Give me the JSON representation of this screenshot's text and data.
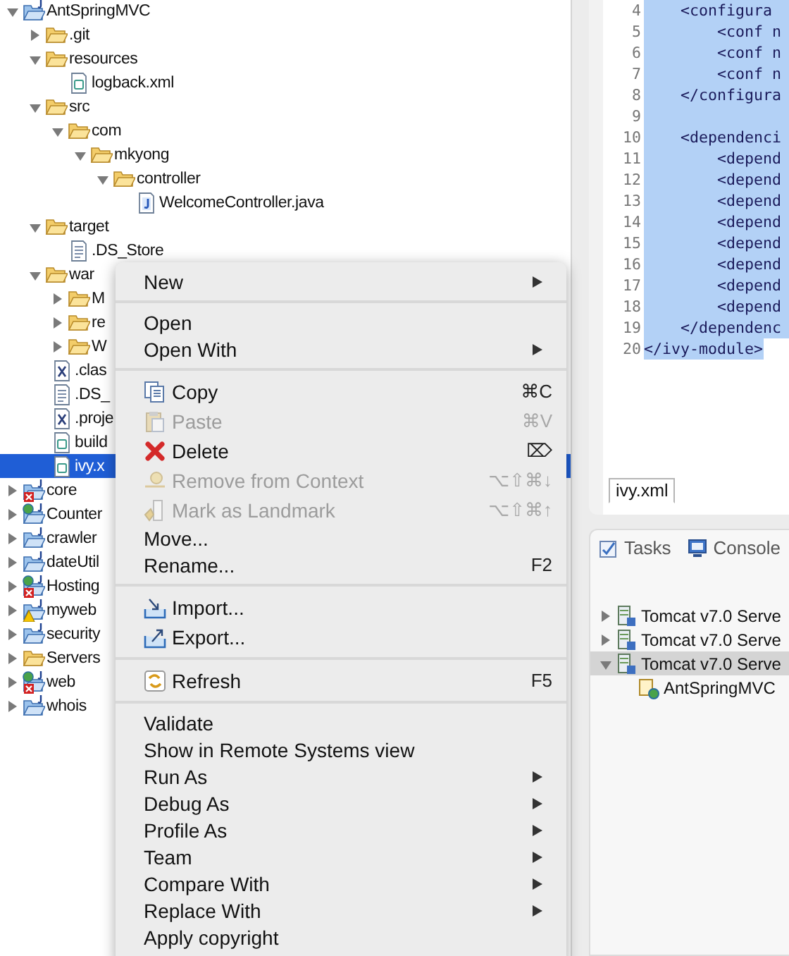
{
  "project_tree": {
    "items": [
      {
        "label": "AntSpringMVC",
        "kind": "project",
        "expanded": true,
        "selected": false,
        "children": [
          {
            "label": ".git",
            "kind": "folder",
            "expanded": false,
            "selected": false
          },
          {
            "label": "resources",
            "kind": "folder",
            "expanded": true,
            "selected": false,
            "children": [
              {
                "label": "logback.xml",
                "kind": "xml",
                "selected": false
              }
            ]
          },
          {
            "label": "src",
            "kind": "folder",
            "expanded": true,
            "selected": false,
            "children": [
              {
                "label": "com",
                "kind": "folder",
                "expanded": true,
                "selected": false,
                "children": [
                  {
                    "label": "mkyong",
                    "kind": "folder",
                    "expanded": true,
                    "selected": false,
                    "children": [
                      {
                        "label": "controller",
                        "kind": "folder",
                        "expanded": true,
                        "selected": false,
                        "children": [
                          {
                            "label": "WelcomeController.java",
                            "kind": "java",
                            "selected": false
                          }
                        ]
                      }
                    ]
                  }
                ]
              }
            ]
          },
          {
            "label": "target",
            "kind": "folder",
            "expanded": true,
            "selected": false,
            "children": [
              {
                "label": ".DS_Store",
                "kind": "text",
                "selected": false
              }
            ]
          },
          {
            "label": "war",
            "kind": "folder",
            "expanded": true,
            "selected": false,
            "children": [
              {
                "label": "M",
                "kind": "folder",
                "expanded": false,
                "selected": false
              },
              {
                "label": "re",
                "kind": "folder",
                "expanded": false,
                "selected": false
              },
              {
                "label": "W",
                "kind": "folder",
                "expanded": false,
                "selected": false
              },
              {
                "label": ".clas",
                "kind": "x-file",
                "selected": false
              },
              {
                "label": ".DS_",
                "kind": "text",
                "selected": false
              },
              {
                "label": ".proje",
                "kind": "x-file",
                "selected": false
              },
              {
                "label": "build",
                "kind": "xml",
                "selected": false
              },
              {
                "label": "ivy.x",
                "kind": "xml",
                "selected": true
              }
            ]
          }
        ]
      },
      {
        "label": "core",
        "kind": "project-error",
        "expanded": false,
        "selected": false
      },
      {
        "label": "Counter",
        "kind": "project-web",
        "expanded": false,
        "selected": false
      },
      {
        "label": "crawler",
        "kind": "project",
        "expanded": false,
        "selected": false
      },
      {
        "label": "dateUtil",
        "kind": "project",
        "expanded": false,
        "selected": false
      },
      {
        "label": "Hosting",
        "kind": "project-web-error",
        "expanded": false,
        "selected": false
      },
      {
        "label": "myweb",
        "kind": "project-warning",
        "expanded": false,
        "selected": false
      },
      {
        "label": "security",
        "kind": "project",
        "expanded": false,
        "selected": false
      },
      {
        "label": "Servers",
        "kind": "folder",
        "expanded": false,
        "selected": false
      },
      {
        "label": "web",
        "kind": "project-web-error",
        "expanded": false,
        "selected": false
      },
      {
        "label": "whois",
        "kind": "project",
        "expanded": false,
        "selected": false
      }
    ]
  },
  "editor": {
    "lines": [
      {
        "number": "4",
        "code": "    <configura",
        "selected": true
      },
      {
        "number": "5",
        "code": "        <conf n",
        "selected": true
      },
      {
        "number": "6",
        "code": "        <conf n",
        "selected": true
      },
      {
        "number": "7",
        "code": "        <conf n",
        "selected": true
      },
      {
        "number": "8",
        "code": "    </configura",
        "selected": true
      },
      {
        "number": "9",
        "selected": true
      },
      {
        "number": "10",
        "code": "    <dependenci",
        "selected": true
      },
      {
        "number": "11",
        "code": "        <depend",
        "selected": true
      },
      {
        "number": "12",
        "code": "        <depend",
        "selected": true
      },
      {
        "number": "13",
        "code": "        <depend",
        "selected": true
      },
      {
        "number": "14",
        "code": "        <depend",
        "selected": true
      },
      {
        "number": "15",
        "code": "        <depend",
        "selected": true
      },
      {
        "number": "16",
        "code": "        <depend",
        "selected": true
      },
      {
        "number": "17",
        "code": "        <depend",
        "selected": true
      },
      {
        "number": "18",
        "code": "        <depend",
        "selected": true
      },
      {
        "number": "19",
        "code": "    </dependenc",
        "selected": true
      },
      {
        "number": "20",
        "code": "</ivy-module>",
        "selected": true
      }
    ],
    "tabs": [
      {
        "label": "ivy.xml",
        "selected": true
      }
    ]
  },
  "bottom_panel": {
    "tabs": [
      {
        "label": "Tasks",
        "kind": "tasks",
        "selected": false
      },
      {
        "label": "Console",
        "kind": "console",
        "selected": false
      }
    ],
    "servers": [
      {
        "label": "Tomcat v7.0 Serve",
        "expanded": false,
        "selected": false
      },
      {
        "label": "Tomcat v7.0 Serve",
        "expanded": false,
        "selected": false
      },
      {
        "label": "Tomcat v7.0 Serve",
        "expanded": true,
        "selected": true,
        "children": [
          {
            "label": "AntSpringMVC",
            "selected": false
          }
        ]
      }
    ]
  },
  "context_menu": {
    "groups": [
      {
        "items": [
          {
            "label": "New",
            "kind": "plain",
            "submenu": true,
            "disabled": false
          }
        ]
      },
      {
        "items": [
          {
            "label": "Open",
            "kind": "plain",
            "submenu": false,
            "disabled": false
          },
          {
            "label": "Open With",
            "kind": "plain",
            "submenu": true,
            "disabled": false
          }
        ]
      },
      {
        "items": [
          {
            "label": "Copy",
            "kind": "copy",
            "shortcut": "⌘C",
            "submenu": false,
            "disabled": false
          },
          {
            "label": "Paste",
            "kind": "paste",
            "shortcut": "⌘V",
            "submenu": false,
            "disabled": true
          },
          {
            "label": "Delete",
            "kind": "delete",
            "shortcut": "⌦",
            "submenu": false,
            "disabled": false
          },
          {
            "label": "Remove from Context",
            "kind": "remove",
            "shortcut": "⌥⇧⌘↓",
            "submenu": false,
            "disabled": true
          },
          {
            "label": "Mark as Landmark",
            "kind": "landmark",
            "shortcut": "⌥⇧⌘↑",
            "submenu": false,
            "disabled": true
          },
          {
            "label": "Move...",
            "kind": "plain",
            "submenu": false,
            "disabled": false
          },
          {
            "label": "Rename...",
            "kind": "plain",
            "shortcut": "F2",
            "submenu": false,
            "disabled": false
          }
        ]
      },
      {
        "items": [
          {
            "label": "Import...",
            "kind": "import",
            "submenu": false,
            "disabled": false
          },
          {
            "label": "Export...",
            "kind": "export",
            "submenu": false,
            "disabled": false
          }
        ]
      },
      {
        "items": [
          {
            "label": "Refresh",
            "kind": "refresh",
            "shortcut": "F5",
            "submenu": false,
            "disabled": false
          }
        ]
      },
      {
        "items": [
          {
            "label": "Validate",
            "kind": "plain",
            "submenu": false,
            "disabled": false
          },
          {
            "label": "Show in Remote Systems view",
            "kind": "plain",
            "submenu": false,
            "disabled": false
          },
          {
            "label": "Run As",
            "kind": "plain",
            "submenu": true,
            "disabled": false
          },
          {
            "label": "Debug As",
            "kind": "plain",
            "submenu": true,
            "disabled": false
          },
          {
            "label": "Profile As",
            "kind": "plain",
            "submenu": true,
            "disabled": false
          },
          {
            "label": "Team",
            "kind": "plain",
            "submenu": true,
            "disabled": false
          },
          {
            "label": "Compare With",
            "kind": "plain",
            "submenu": true,
            "disabled": false
          },
          {
            "label": "Replace With",
            "kind": "plain",
            "submenu": true,
            "disabled": false
          },
          {
            "label": "Apply copyright",
            "kind": "plain",
            "submenu": false,
            "disabled": false
          }
        ]
      }
    ]
  }
}
